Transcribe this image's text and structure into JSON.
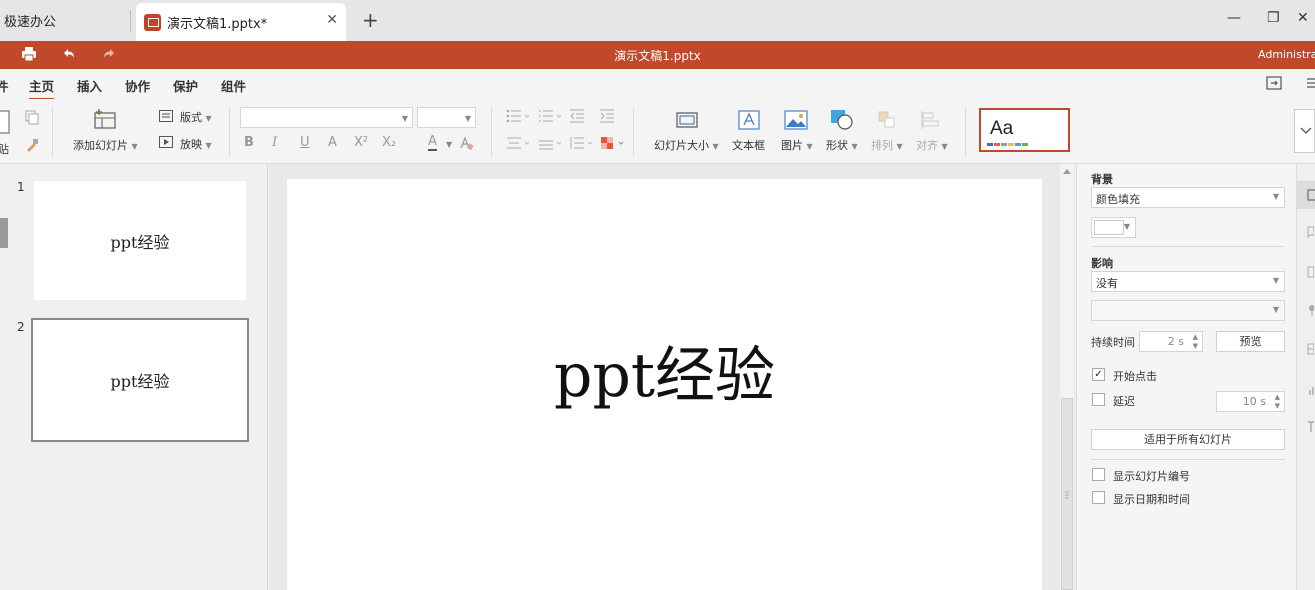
{
  "tabs": {
    "home_tab": "极速办公",
    "doc_tab": "演示文稿1.pptx*",
    "close_glyph": "✕",
    "add_glyph": "+"
  },
  "window": {
    "minimize": "—",
    "restore": "❐",
    "close": "✕"
  },
  "titlebar": {
    "title": "演示文稿1.pptx",
    "user": "Administrato",
    "accent": "#c0482b"
  },
  "menu": {
    "partial_left": "件",
    "items": [
      "主页",
      "插入",
      "协作",
      "保护",
      "组件"
    ],
    "active": "主页"
  },
  "ribbon": {
    "paste_partial": "贴",
    "add_slide": "添加幻灯片",
    "layout": "版式",
    "play": "放映",
    "bold": "B",
    "italic": "I",
    "underline": "U",
    "strike": "A",
    "superscript": "X²",
    "subscript": "X₂",
    "font_color": "A",
    "slide_size": "幻灯片大小",
    "textbox": "文本框",
    "picture": "图片",
    "shape": "形状",
    "arrange": "排列",
    "align": "对齐",
    "theme_sample": "Aa"
  },
  "slides": {
    "thumbnails": [
      {
        "number": "1",
        "text": "ppt经验"
      },
      {
        "number": "2",
        "text": "ppt经验"
      }
    ],
    "selected": "2"
  },
  "canvas": {
    "slide_text": "ppt经验"
  },
  "right_panel": {
    "background_heading": "背景",
    "fill_select": "颜色填充",
    "effect_heading": "影响",
    "effect_select": "没有",
    "duration_label": "持续时间",
    "duration_value": "2 s",
    "preview_button": "预览",
    "start_on_click": "开始点击",
    "start_on_click_checked": true,
    "delay_label": "延迟",
    "delay_value": "10 s",
    "apply_all_button": "适用于所有幻灯片",
    "show_slide_number": "显示幻灯片编号",
    "show_date_time": "显示日期和时间",
    "check_mark": "✓"
  }
}
